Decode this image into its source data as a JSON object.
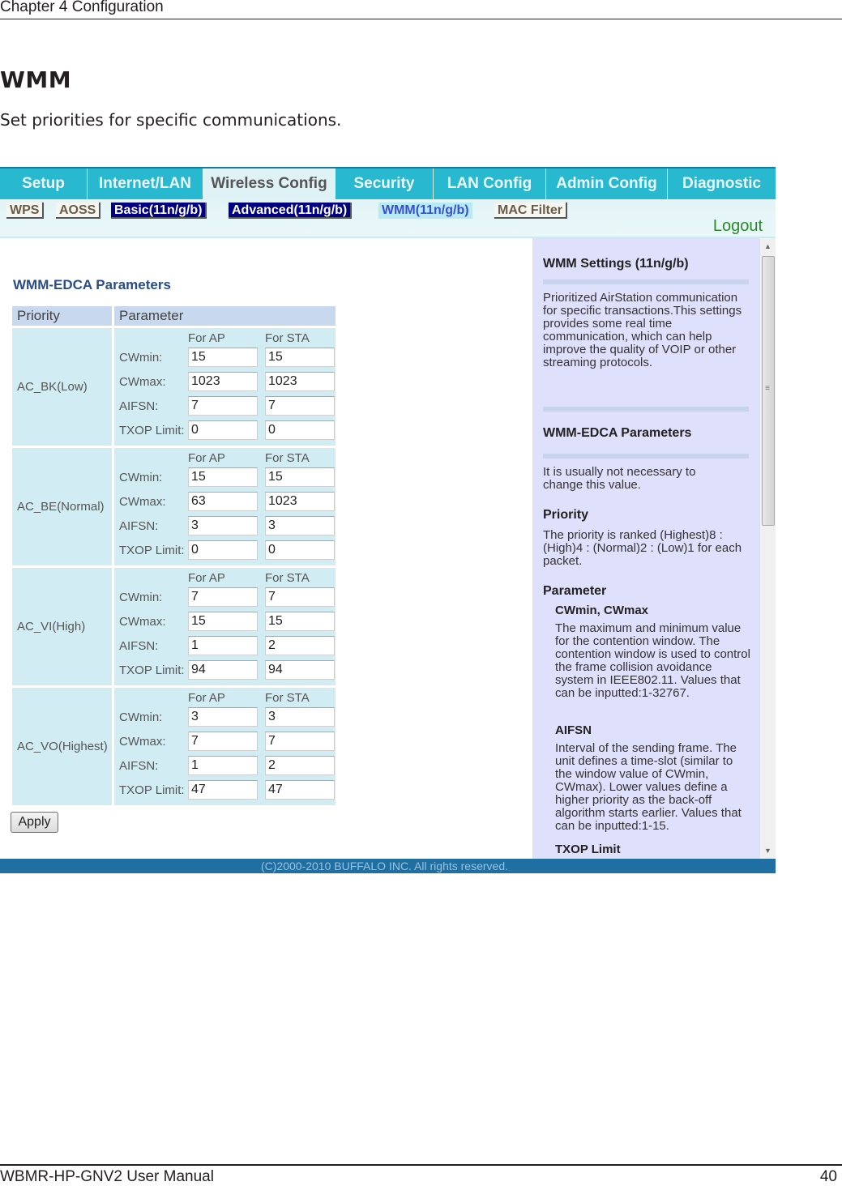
{
  "chapter_header": "Chapter 4  Configuration",
  "doc_title": "WMM",
  "doc_subtitle": "Set priorities for specific communications.",
  "ui": {
    "top_tabs": [
      {
        "label": "Setup",
        "active": false
      },
      {
        "label": "Internet/LAN",
        "active": false
      },
      {
        "label": "Wireless Config",
        "active": true
      },
      {
        "label": "Security",
        "active": false
      },
      {
        "label": "LAN Config",
        "active": false
      },
      {
        "label": "Admin Config",
        "active": false
      },
      {
        "label": "Diagnostic",
        "active": false
      }
    ],
    "sub_tabs": [
      {
        "label": "WPS"
      },
      {
        "label": "AOSS"
      },
      {
        "label": "Basic(11n/g/b)"
      },
      {
        "label": "Advanced(11n/g/b)"
      },
      {
        "label": "WMM(11n/g/b)",
        "current": true
      },
      {
        "label": "MAC Filter"
      }
    ],
    "logout_label": "Logout",
    "section_title": "WMM-EDCA Parameters",
    "table": {
      "headers": [
        "Priority",
        "Parameter"
      ],
      "col_for_ap": "For AP",
      "col_for_sta": "For STA",
      "param_labels": [
        "CWmin:",
        "CWmax:",
        "AIFSN:",
        "TXOP Limit:"
      ],
      "rows": [
        {
          "priority": "AC_BK(Low)",
          "ap": [
            "15",
            "1023",
            "7",
            "0"
          ],
          "sta": [
            "15",
            "1023",
            "7",
            "0"
          ]
        },
        {
          "priority": "AC_BE(Normal)",
          "ap": [
            "15",
            "63",
            "3",
            "0"
          ],
          "sta": [
            "15",
            "1023",
            "3",
            "0"
          ]
        },
        {
          "priority": "AC_VI(High)",
          "ap": [
            "7",
            "15",
            "1",
            "94"
          ],
          "sta": [
            "7",
            "15",
            "2",
            "94"
          ]
        },
        {
          "priority": "AC_VO(Highest)",
          "ap": [
            "3",
            "7",
            "1",
            "47"
          ],
          "sta": [
            "3",
            "7",
            "2",
            "47"
          ]
        }
      ]
    },
    "apply_label": "Apply",
    "help": {
      "title": "WMM Settings (11n/g/b)",
      "intro": "Prioritized AirStation communication for specific transactions.This settings provides some real time communication, which can help improve the quality of VOIP or other streaming protocols.",
      "edca_title": "WMM-EDCA Parameters",
      "edca_text": "It is usually not necessary to change this value.",
      "priority_title": "Priority",
      "priority_text": "The priority is ranked (Highest)8 : (High)4 : (Normal)2 : (Low)1 for each packet.",
      "parameter_title": "Parameter",
      "cw_title": "CWmin, CWmax",
      "cw_text": "The maximum and minimum value for the contention window. The contention window is used to control the frame collision avoidance system in IEEE802.11. Values that can be inputted:1-32767.",
      "aifsn_title": "AIFSN",
      "aifsn_text": "Interval of the sending frame. The unit defines a time-slot (similar to the window value of CWmin, CWmax). Lower values define a higher priority as the back-off algorithm starts earlier. Values that can be inputted:1-15.",
      "txop_title": "TXOP Limit"
    },
    "copyright": "(C)2000-2010 BUFFALO INC. All rights reserved."
  },
  "page_footer": {
    "manual_name": "WBMR-HP-GNV2 User Manual",
    "page_number": "40"
  }
}
